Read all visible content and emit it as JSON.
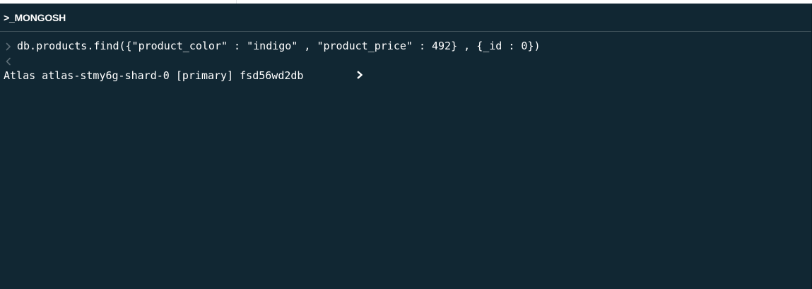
{
  "header": {
    "title": ">_MONGOSH"
  },
  "console": {
    "history": [
      {
        "input_icon": "chevron-right-icon",
        "command": "db.products.find({\"product_color\" : \"indigo\" , \"product_price\" : 492} , {_id : 0})",
        "output_icon": "chevron-left-icon",
        "output": ""
      }
    ],
    "prompt": {
      "text": "Atlas atlas-stmy6g-shard-0 [primary] fsd56wd2db",
      "caret_icon": "prompt-chevron-icon",
      "input_value": ""
    }
  },
  "colors": {
    "background": "#112733",
    "header_border": "#3d4f58",
    "text": "#ffffff",
    "history_icon": "#5c6c75"
  }
}
